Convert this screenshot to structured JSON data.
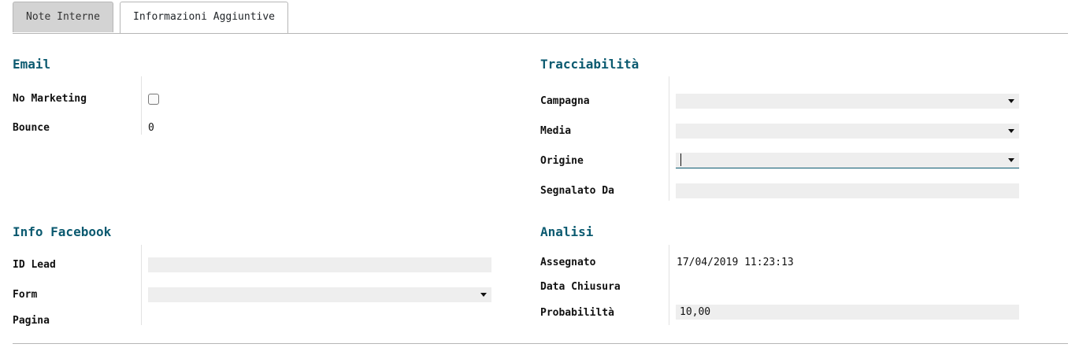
{
  "tabs": [
    {
      "label": "Note Interne",
      "active": false
    },
    {
      "label": "Informazioni Aggiuntive",
      "active": true
    }
  ],
  "email": {
    "title": "Email",
    "no_marketing_label": "No Marketing",
    "no_marketing_checked": false,
    "bounce_label": "Bounce",
    "bounce_value": "0"
  },
  "tracciabilita": {
    "title": "Tracciabilità",
    "campagna_label": "Campagna",
    "campagna_value": "",
    "media_label": "Media",
    "media_value": "",
    "origine_label": "Origine",
    "origine_value": "",
    "segnalato_label": "Segnalato Da",
    "segnalato_value": ""
  },
  "facebook": {
    "title": "Info Facebook",
    "id_lead_label": "ID Lead",
    "id_lead_value": "",
    "form_label": "Form",
    "form_value": "",
    "pagina_label": "Pagina",
    "pagina_value": ""
  },
  "analisi": {
    "title": "Analisi",
    "assegnato_label": "Assegnato",
    "assegnato_value": "17/04/2019 11:23:13",
    "chiusura_label": "Data Chiusura",
    "chiusura_value": "",
    "probabilita_label": "Probabililtà",
    "probabilita_value": "10,00"
  },
  "colors": {
    "section_title": "#0b5a70",
    "field_bg": "#eeeeee",
    "tab_inactive_bg": "#d3d3d3"
  }
}
